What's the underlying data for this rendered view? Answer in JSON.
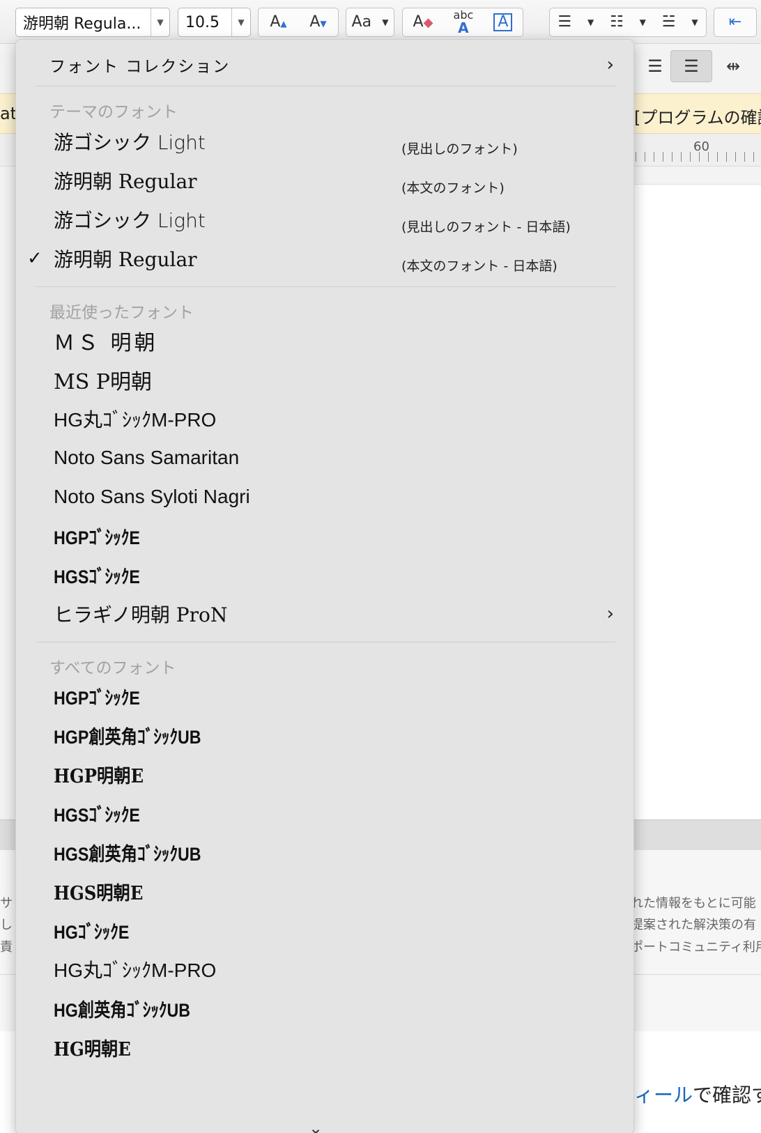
{
  "toolbar": {
    "font_name": "游明朝 Regula...",
    "font_size": "10.5",
    "grow_font": "A",
    "shrink_font": "A",
    "change_case": "Aa",
    "clear_format": "A",
    "text_effect": "abc",
    "text_box": "A"
  },
  "background": {
    "message_left": "ate",
    "message_right": "[プログラムの確認] を選",
    "ruler_number": "60",
    "web_lines": [
      "れた情報をもとに可能",
      "提案された解決策の有",
      "ポートコミュニティ利用規"
    ],
    "left_chars": [
      "サ",
      "し",
      "責"
    ],
    "link_prefix": "ィール",
    "link_suffix": "で確認す"
  },
  "menu": {
    "collection": "フォント コレクション",
    "theme_header": "テーマのフォント",
    "theme_fonts": [
      {
        "label": "游ゴシック Light",
        "note": "(見出しのフォント)",
        "checked": false
      },
      {
        "label": "游明朝 Regular",
        "note": "(本文のフォント)",
        "checked": false
      },
      {
        "label": "游ゴシック Light",
        "note": "(見出しのフォント - 日本語)",
        "checked": false
      },
      {
        "label": "游明朝 Regular",
        "note": "(本文のフォント - 日本語)",
        "checked": true
      }
    ],
    "recent_header": "最近使ったフォント",
    "recent_fonts": [
      "ＭＳ 明朝",
      "MS P明朝",
      "HG丸ｺﾞｼｯｸM-PRO",
      "Noto Sans Samaritan",
      "Noto Sans Syloti Nagri",
      "HGPｺﾞｼｯｸE",
      "HGSｺﾞｼｯｸE",
      "ヒラギノ明朝 ProN"
    ],
    "all_header": "すべてのフォント",
    "all_fonts": [
      "HGPｺﾞｼｯｸE",
      "HGP創英角ｺﾞｼｯｸUB",
      "HGP明朝E",
      "HGSｺﾞｼｯｸE",
      "HGS創英角ｺﾞｼｯｸUB",
      "HGS明朝E",
      "HGｺﾞｼｯｸE",
      "HG丸ｺﾞｼｯｸM-PRO",
      "HG創英角ｺﾞｼｯｸUB",
      "HG明朝E"
    ]
  }
}
